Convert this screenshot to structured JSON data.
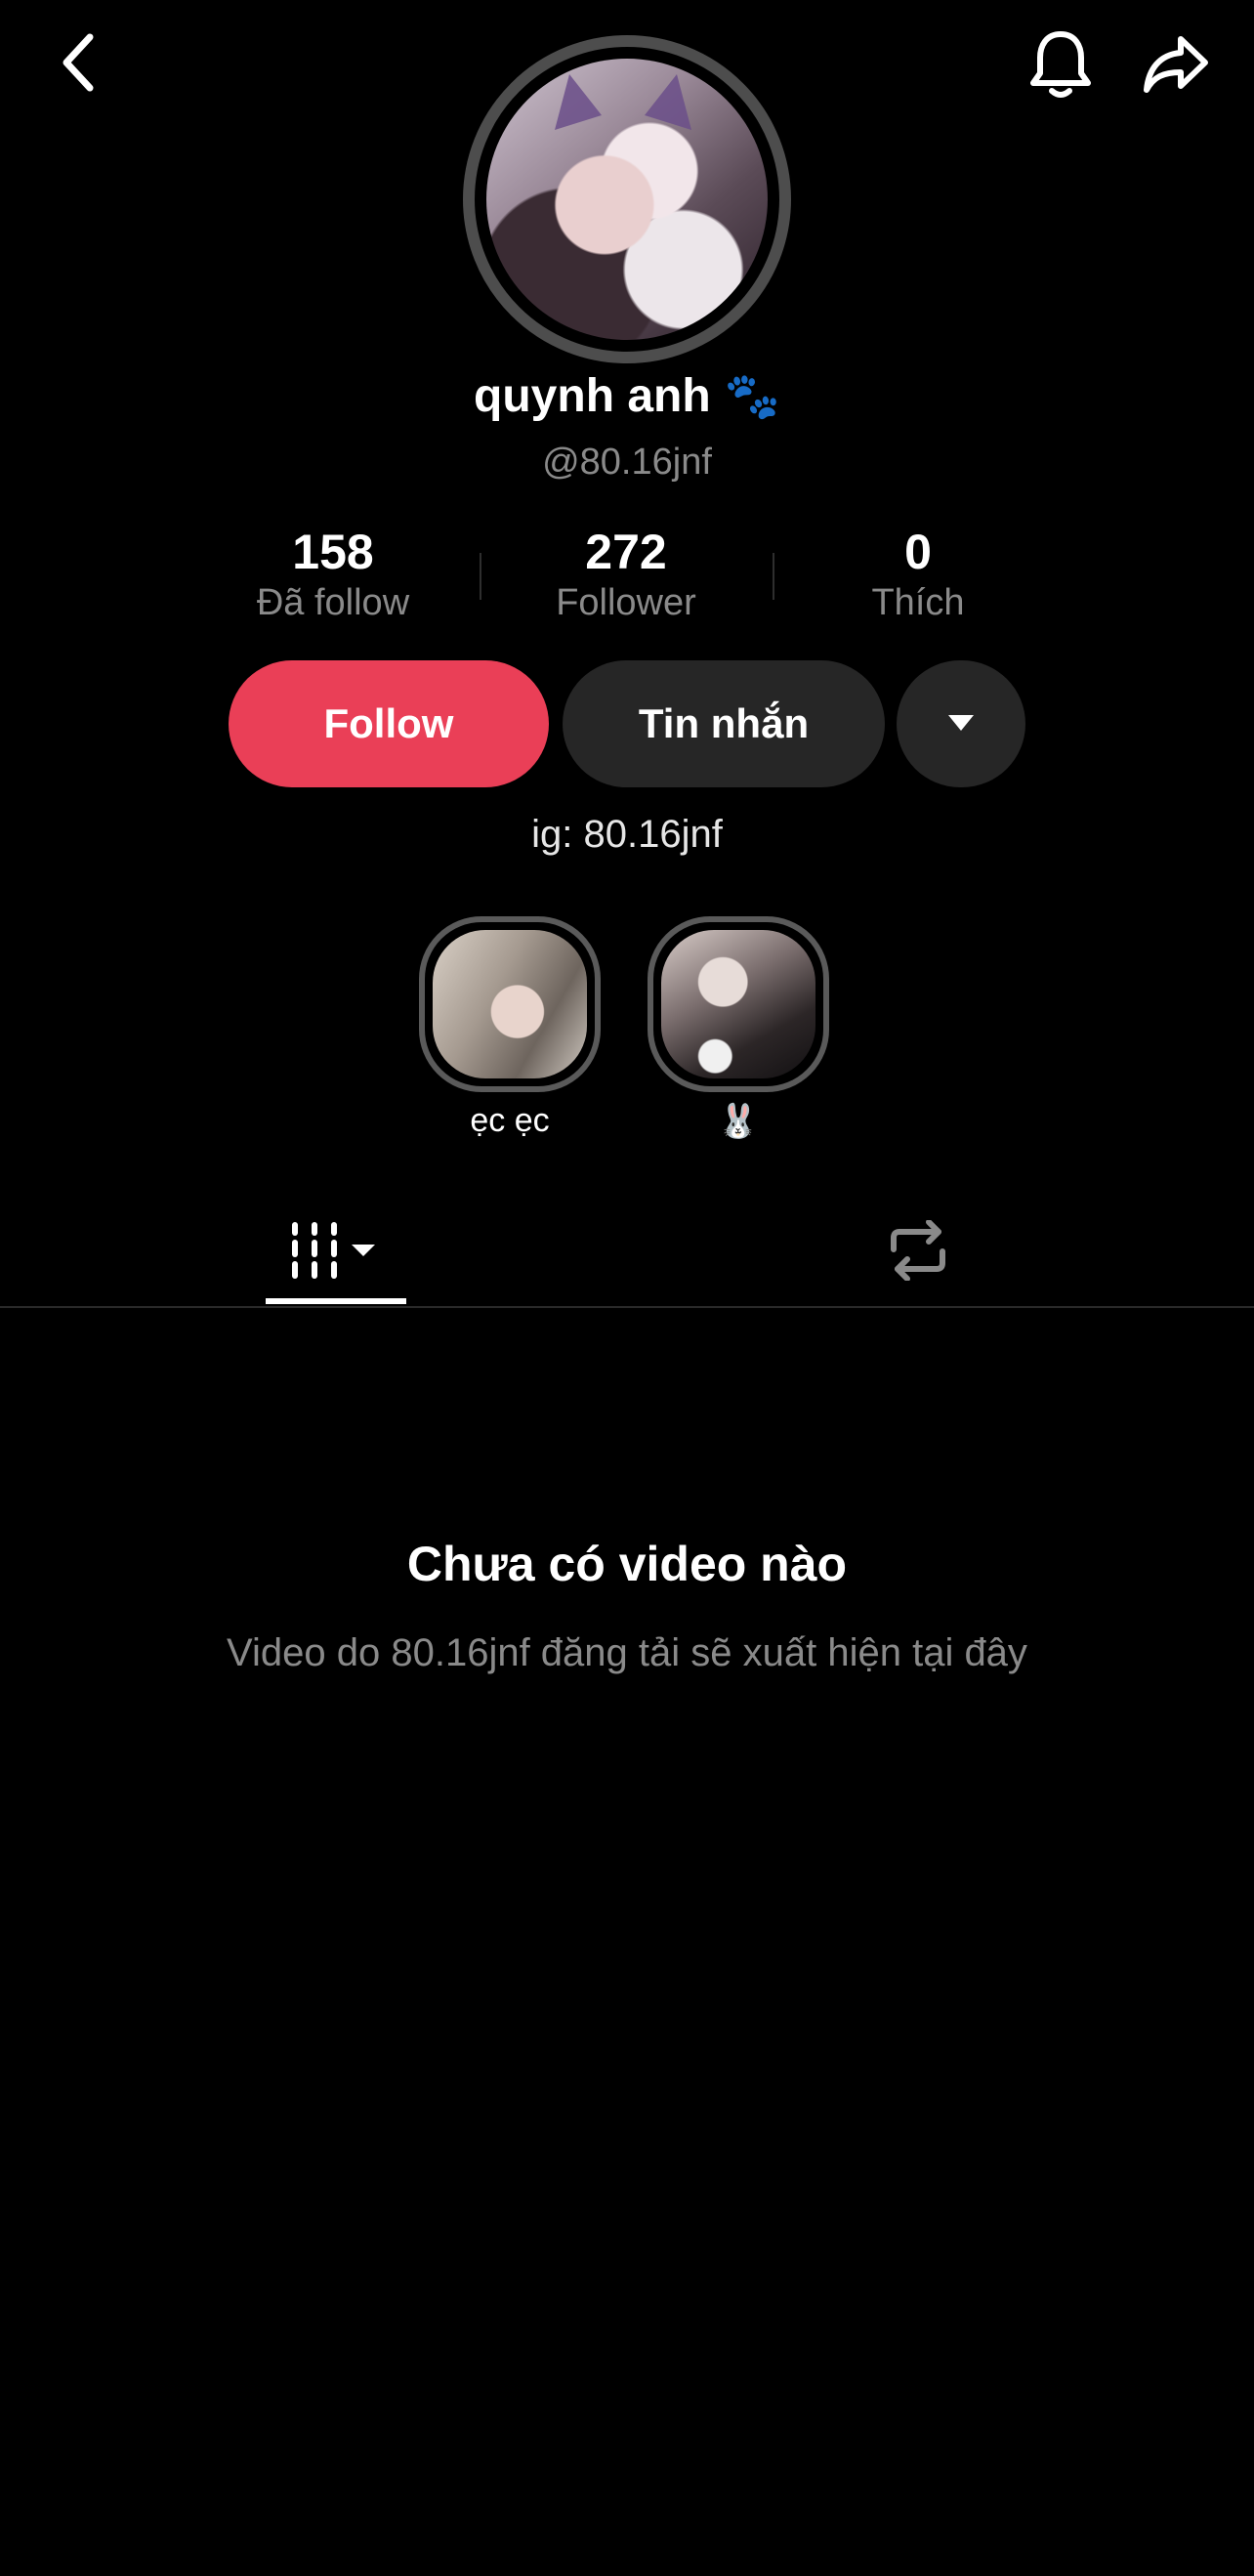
{
  "topbar": {
    "back_icon": "chevron-left-icon",
    "bell_icon": "bell-icon",
    "share_icon": "share-arrow-icon"
  },
  "profile": {
    "name": "quynh anh",
    "name_emoji": "🐾",
    "handle": "@80.16jnf",
    "bio": "ig: 80.16jnf"
  },
  "stats": [
    {
      "value": "158",
      "label": "Đã follow"
    },
    {
      "value": "272",
      "label": "Follower"
    },
    {
      "value": "0",
      "label": "Thích"
    }
  ],
  "actions": {
    "follow_label": "Follow",
    "message_label": "Tin nhắn",
    "follow_color": "#ea3f57"
  },
  "highlights": [
    {
      "label": "ẹc ẹc"
    },
    {
      "label": "🐰"
    }
  ],
  "tabs": {
    "videos_icon": "grid-columns-icon",
    "reposts_icon": "repost-icon"
  },
  "empty_state": {
    "title": "Chưa có video nào",
    "subtitle": "Video do 80.16jnf đăng tải sẽ xuất hiện tại đây"
  }
}
